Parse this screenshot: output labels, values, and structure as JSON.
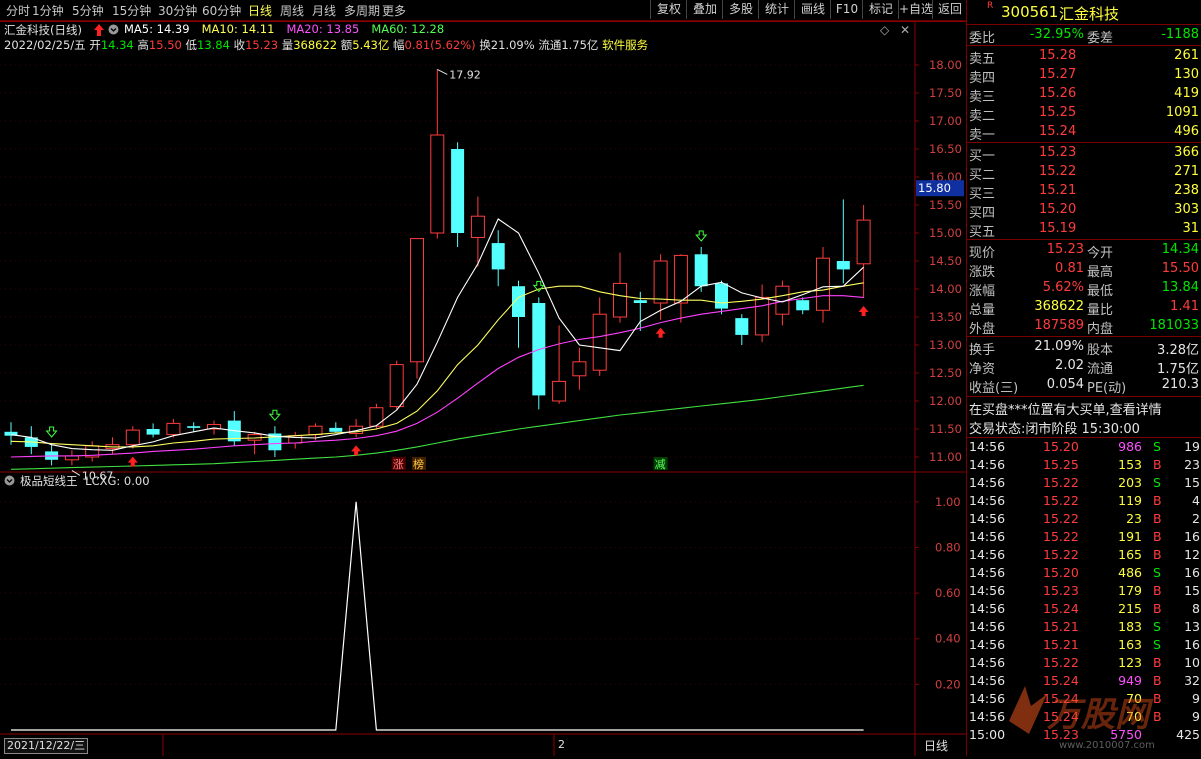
{
  "toolbar": {
    "timeframes": [
      "分时",
      "1分钟",
      "5分钟",
      "15分钟",
      "30分钟",
      "60分钟",
      "日线",
      "周线",
      "月线",
      "多周期",
      "更多"
    ],
    "active": "日线",
    "buttons": [
      "复权",
      "叠加",
      "多股",
      "统计",
      "画线",
      "F10",
      "标记",
      "+自选",
      "返回"
    ]
  },
  "header": {
    "title": "汇金科技(日线)",
    "ma": [
      {
        "label": "MA5: 14.39",
        "color": "#ffffff"
      },
      {
        "label": "MA10: 14.11",
        "color": "#ffff50"
      },
      {
        "label": "MA20: 13.85",
        "color": "#ff50ff"
      },
      {
        "label": "MA60: 12.28",
        "color": "#50ff50"
      }
    ],
    "date": "2022/02/25/五",
    "open_label": "开",
    "open": "14.34",
    "high_label": "高",
    "high": "15.50",
    "low_label": "低",
    "low": "13.84",
    "close_label": "收",
    "close": "15.23",
    "vol_label": "量",
    "vol": "368622",
    "amt_label": "额",
    "amt": "5.43亿",
    "chg_label": "幅",
    "chg": "0.81(5.62%)",
    "turnover": "换21.09%",
    "float": "流通1.75亿",
    "industry": "软件服务"
  },
  "chart_data": [
    {
      "type": "candlestick",
      "title": "汇金科技(日线)",
      "yticks": [
        "18.00",
        "17.50",
        "17.00",
        "16.50",
        "16.00",
        "15.50",
        "15.00",
        "14.50",
        "14.00",
        "13.50",
        "13.00",
        "12.50",
        "12.00",
        "11.50",
        "11.00"
      ],
      "ylim": [
        10.75,
        18.25
      ],
      "current_price_tag": "15.80",
      "annotations": {
        "high": "17.92",
        "low": "10.67",
        "marker_zhang": "涨",
        "marker_bang": "榜",
        "marker_jian": "减"
      },
      "candles": [
        {
          "o": 11.45,
          "h": 11.62,
          "l": 11.22,
          "c": 11.38
        },
        {
          "o": 11.35,
          "h": 11.55,
          "l": 11.05,
          "c": 11.18
        },
        {
          "o": 11.1,
          "h": 11.25,
          "l": 10.85,
          "c": 10.95
        },
        {
          "o": 10.95,
          "h": 11.12,
          "l": 10.85,
          "c": 11.02
        },
        {
          "o": 11.0,
          "h": 11.28,
          "l": 10.92,
          "c": 11.2
        },
        {
          "o": 11.15,
          "h": 11.35,
          "l": 11.05,
          "c": 11.22
        },
        {
          "o": 11.22,
          "h": 11.55,
          "l": 11.15,
          "c": 11.48
        },
        {
          "o": 11.5,
          "h": 11.6,
          "l": 11.35,
          "c": 11.4
        },
        {
          "o": 11.4,
          "h": 11.68,
          "l": 11.35,
          "c": 11.6
        },
        {
          "o": 11.55,
          "h": 11.62,
          "l": 11.45,
          "c": 11.52
        },
        {
          "o": 11.5,
          "h": 11.65,
          "l": 11.4,
          "c": 11.58
        },
        {
          "o": 11.65,
          "h": 11.82,
          "l": 11.2,
          "c": 11.28
        },
        {
          "o": 11.3,
          "h": 11.45,
          "l": 11.05,
          "c": 11.4
        },
        {
          "o": 11.42,
          "h": 11.55,
          "l": 11.0,
          "c": 11.12
        },
        {
          "o": 11.25,
          "h": 11.45,
          "l": 11.15,
          "c": 11.38
        },
        {
          "o": 11.4,
          "h": 11.6,
          "l": 11.3,
          "c": 11.55
        },
        {
          "o": 11.52,
          "h": 11.62,
          "l": 11.42,
          "c": 11.45
        },
        {
          "o": 11.42,
          "h": 11.68,
          "l": 11.35,
          "c": 11.55
        },
        {
          "o": 11.55,
          "h": 11.95,
          "l": 11.5,
          "c": 11.88
        },
        {
          "o": 11.9,
          "h": 12.72,
          "l": 11.85,
          "c": 12.65
        },
        {
          "o": 12.7,
          "h": 14.28,
          "l": 12.4,
          "c": 14.9
        },
        {
          "o": 15.0,
          "h": 17.92,
          "l": 14.9,
          "c": 16.75
        },
        {
          "o": 16.5,
          "h": 16.62,
          "l": 14.75,
          "c": 15.0
        },
        {
          "o": 14.92,
          "h": 15.65,
          "l": 14.4,
          "c": 15.3
        },
        {
          "o": 14.82,
          "h": 15.05,
          "l": 14.05,
          "c": 14.35
        },
        {
          "o": 14.05,
          "h": 14.15,
          "l": 12.95,
          "c": 13.5
        },
        {
          "o": 13.75,
          "h": 13.85,
          "l": 11.85,
          "c": 12.1
        },
        {
          "o": 12.0,
          "h": 13.35,
          "l": 11.95,
          "c": 12.35
        },
        {
          "o": 12.45,
          "h": 12.95,
          "l": 12.2,
          "c": 12.7
        },
        {
          "o": 12.55,
          "h": 13.85,
          "l": 12.45,
          "c": 13.55
        },
        {
          "o": 13.5,
          "h": 14.65,
          "l": 13.4,
          "c": 14.1
        },
        {
          "o": 13.8,
          "h": 13.95,
          "l": 13.25,
          "c": 13.75
        },
        {
          "o": 13.75,
          "h": 14.62,
          "l": 13.45,
          "c": 14.5
        },
        {
          "o": 13.75,
          "h": 14.62,
          "l": 13.4,
          "c": 14.6
        },
        {
          "o": 14.62,
          "h": 14.75,
          "l": 13.95,
          "c": 14.05
        },
        {
          "o": 14.1,
          "h": 14.15,
          "l": 13.55,
          "c": 13.65
        },
        {
          "o": 13.48,
          "h": 13.55,
          "l": 13.0,
          "c": 13.18
        },
        {
          "o": 13.18,
          "h": 14.08,
          "l": 13.05,
          "c": 13.85
        },
        {
          "o": 13.55,
          "h": 14.15,
          "l": 13.35,
          "c": 14.05
        },
        {
          "o": 13.8,
          "h": 13.85,
          "l": 13.55,
          "c": 13.62
        },
        {
          "o": 13.62,
          "h": 14.75,
          "l": 13.4,
          "c": 14.55
        },
        {
          "o": 14.5,
          "h": 15.6,
          "l": 14.1,
          "c": 14.35
        },
        {
          "o": 14.45,
          "h": 15.5,
          "l": 13.84,
          "c": 15.23
        }
      ],
      "ma5": [
        11.4,
        11.35,
        11.22,
        11.15,
        11.13,
        11.12,
        11.2,
        11.27,
        11.38,
        11.45,
        11.52,
        11.47,
        11.43,
        11.37,
        11.35,
        11.34,
        11.4,
        11.47,
        11.56,
        11.84,
        12.3,
        13.05,
        13.85,
        14.45,
        15.25,
        15.0,
        14.28,
        13.48,
        13.0,
        12.95,
        12.9,
        13.42,
        13.62,
        13.78,
        14.05,
        14.12,
        13.93,
        13.84,
        13.77,
        13.9,
        14.04,
        14.05,
        14.39
      ],
      "ma10": [
        11.28,
        11.27,
        11.24,
        11.22,
        11.2,
        11.18,
        11.18,
        11.2,
        11.25,
        11.28,
        11.32,
        11.33,
        11.34,
        11.36,
        11.38,
        11.4,
        11.43,
        11.45,
        11.5,
        11.6,
        11.82,
        12.18,
        12.65,
        13.0,
        13.45,
        13.85,
        14.0,
        14.05,
        14.05,
        13.95,
        13.88,
        13.83,
        13.82,
        13.8,
        13.8,
        13.75,
        13.78,
        13.82,
        13.88,
        13.95,
        13.98,
        14.05,
        14.11
      ],
      "ma20": [
        11.0,
        11.01,
        11.02,
        11.02,
        11.03,
        11.05,
        11.07,
        11.1,
        11.12,
        11.14,
        11.17,
        11.2,
        11.22,
        11.24,
        11.25,
        11.28,
        11.3,
        11.33,
        11.38,
        11.46,
        11.6,
        11.8,
        12.05,
        12.32,
        12.58,
        12.78,
        12.92,
        13.02,
        13.1,
        13.15,
        13.22,
        13.3,
        13.4,
        13.48,
        13.55,
        13.6,
        13.65,
        13.7,
        13.78,
        13.83,
        13.88,
        13.88,
        13.85
      ],
      "ma60": [
        10.78,
        10.79,
        10.8,
        10.81,
        10.82,
        10.83,
        10.84,
        10.85,
        10.86,
        10.87,
        10.88,
        10.9,
        10.92,
        10.94,
        10.96,
        10.98,
        11.0,
        11.03,
        11.07,
        11.12,
        11.18,
        11.25,
        11.32,
        11.38,
        11.44,
        11.5,
        11.55,
        11.6,
        11.65,
        11.7,
        11.75,
        11.79,
        11.83,
        11.87,
        11.91,
        11.95,
        11.99,
        12.03,
        12.08,
        12.13,
        12.18,
        12.23,
        12.28
      ],
      "up_arrows": [
        6,
        17,
        32,
        42
      ],
      "down_arrows": [
        2,
        13,
        26,
        34
      ]
    },
    {
      "type": "line",
      "title": "极品短线王",
      "series": [
        {
          "name": "LCXG",
          "values": [
            0,
            0,
            0,
            0,
            0,
            0,
            0,
            0,
            0,
            0,
            0,
            0,
            0,
            0,
            0,
            0,
            0,
            1,
            0,
            0,
            0,
            0,
            0,
            0,
            0,
            0,
            0,
            0,
            0,
            0,
            0,
            0,
            0,
            0,
            0,
            0,
            0,
            0,
            0,
            0,
            0,
            0,
            0
          ]
        }
      ],
      "legend_value": "0.00",
      "yticks": [
        "1.00",
        "0.80",
        "0.60",
        "0.40",
        "0.20"
      ],
      "ylim": [
        0,
        1.1
      ]
    }
  ],
  "indicator": {
    "title": "极品短线王",
    "series_label": "LCXG: 0.00"
  },
  "bottom": {
    "date_box": "2021/12/22/三",
    "mark_2": "2",
    "period": "日线"
  },
  "panel": {
    "code": "300561",
    "name": "汇金科技",
    "weibi_label": "委比",
    "weibi": "-32.95%",
    "weicha_label": "委差",
    "weicha": "-1188",
    "asks": [
      {
        "label": "卖五",
        "price": "15.28",
        "vol": "261"
      },
      {
        "label": "卖四",
        "price": "15.27",
        "vol": "130"
      },
      {
        "label": "卖三",
        "price": "15.26",
        "vol": "419"
      },
      {
        "label": "卖二",
        "price": "15.25",
        "vol": "1091"
      },
      {
        "label": "卖一",
        "price": "15.24",
        "vol": "496"
      }
    ],
    "bids": [
      {
        "label": "买一",
        "price": "15.23",
        "vol": "366"
      },
      {
        "label": "买二",
        "price": "15.22",
        "vol": "271"
      },
      {
        "label": "买三",
        "price": "15.21",
        "vol": "238"
      },
      {
        "label": "买四",
        "price": "15.20",
        "vol": "303"
      },
      {
        "label": "买五",
        "price": "15.19",
        "vol": "31"
      }
    ],
    "quote": [
      {
        "l1": "现价",
        "v1": "15.23",
        "l2": "今开",
        "v2": "14.34"
      },
      {
        "l1": "涨跌",
        "v1": "0.81",
        "l2": "最高",
        "v2": "15.50"
      },
      {
        "l1": "涨幅",
        "v1": "5.62%",
        "l2": "最低",
        "v2": "13.84"
      },
      {
        "l1": "总量",
        "v1": "368622",
        "l2": "量比",
        "v2": "1.41"
      },
      {
        "l1": "外盘",
        "v1": "187589",
        "l2": "内盘",
        "v2": "181033"
      }
    ],
    "fund": [
      {
        "l1": "换手",
        "v1": "21.09%",
        "l2": "股本",
        "v2": "3.28亿"
      },
      {
        "l1": "净资",
        "v1": "2.02",
        "l2": "流通",
        "v2": "1.75亿"
      },
      {
        "l1": "收益(三)",
        "v1": "0.054",
        "l2": "PE(动)",
        "v2": "210.3"
      }
    ],
    "notice": "在买盘***位置有大买单,查看详情",
    "status": "交易状态:闭市阶段 15:30:00",
    "ticks": [
      {
        "t": "14:56",
        "p": "15.20",
        "v": "986",
        "s": "S",
        "n": "19"
      },
      {
        "t": "14:56",
        "p": "15.25",
        "v": "153",
        "s": "B",
        "n": "23"
      },
      {
        "t": "14:56",
        "p": "15.22",
        "v": "203",
        "s": "S",
        "n": "15"
      },
      {
        "t": "14:56",
        "p": "15.22",
        "v": "119",
        "s": "B",
        "n": "4"
      },
      {
        "t": "14:56",
        "p": "15.22",
        "v": "23",
        "s": "B",
        "n": "2"
      },
      {
        "t": "14:56",
        "p": "15.22",
        "v": "191",
        "s": "B",
        "n": "16"
      },
      {
        "t": "14:56",
        "p": "15.22",
        "v": "165",
        "s": "B",
        "n": "12"
      },
      {
        "t": "14:56",
        "p": "15.20",
        "v": "486",
        "s": "S",
        "n": "16"
      },
      {
        "t": "14:56",
        "p": "15.23",
        "v": "179",
        "s": "B",
        "n": "15"
      },
      {
        "t": "14:56",
        "p": "15.24",
        "v": "215",
        "s": "B",
        "n": "8"
      },
      {
        "t": "14:56",
        "p": "15.21",
        "v": "183",
        "s": "S",
        "n": "13"
      },
      {
        "t": "14:56",
        "p": "15.21",
        "v": "163",
        "s": "S",
        "n": "16"
      },
      {
        "t": "14:56",
        "p": "15.22",
        "v": "123",
        "s": "B",
        "n": "10"
      },
      {
        "t": "14:56",
        "p": "15.24",
        "v": "949",
        "s": "B",
        "n": "32"
      },
      {
        "t": "14:56",
        "p": "15.24",
        "v": "70",
        "s": "B",
        "n": "9"
      },
      {
        "t": "14:56",
        "p": "15.24",
        "v": "70",
        "s": "B",
        "n": "9"
      },
      {
        "t": "15:00",
        "p": "15.23",
        "v": "5750",
        "s": "",
        "n": "425"
      }
    ],
    "watermark": "万股网",
    "watermark_url": "www.2010007.com"
  }
}
